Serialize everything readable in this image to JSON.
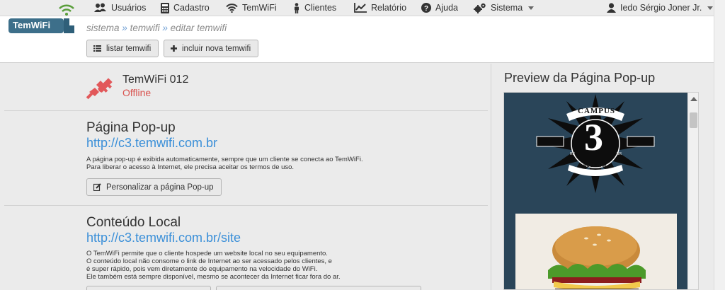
{
  "nav": {
    "items": [
      {
        "label": "Usuários",
        "icon": "users-icon"
      },
      {
        "label": "Cadastro",
        "icon": "calculator-icon"
      },
      {
        "label": "TemWiFi",
        "icon": "wifi-icon"
      },
      {
        "label": "Clientes",
        "icon": "person-icon"
      },
      {
        "label": "Relatório",
        "icon": "chart-icon"
      },
      {
        "label": "Ajuda",
        "icon": "help-icon"
      },
      {
        "label": "Sistema",
        "icon": "gears-icon"
      }
    ],
    "user": "Iedo Sérgio Joner Jr."
  },
  "logo": {
    "text": "TemWiFi"
  },
  "breadcrumb": {
    "part1": "sistema",
    "sep": "»",
    "part2": "temwifi",
    "part3": "editar temwifi"
  },
  "toolbar": {
    "list_label": "listar temwifi",
    "add_label": "incluir nova temwifi"
  },
  "device": {
    "name": "TemWiFi 012",
    "status": "Offline"
  },
  "popup": {
    "title": "Página Pop-up",
    "url": "http://c3.temwifi.com.br",
    "desc1": "A página pop-up é exibida automaticamente, sempre que um cliente se conecta ao TemWiFi.",
    "desc2": "Para liberar o acesso à Internet, ele precisa aceitar os termos de uso.",
    "button": "Personalizar a página Pop-up"
  },
  "local": {
    "title": "Conteúdo Local",
    "url": "http://c3.temwifi.com.br/site",
    "desc1": "O TemWiFi permite que o cliente hospede um website local no seu equipamento.",
    "desc2": "O conteúdo local não consome o link de Internet ao ser acessado pelos clientes, e",
    "desc3": "é super rápido, pois vem diretamente do equipamento na velocidade do WiFi.",
    "desc4": "Ele também está sempre disponível, mesmo se acontecer da Internet ficar fora do ar."
  },
  "preview": {
    "title": "Preview da Página Pop-up",
    "logo_top": "CAMPUS",
    "logo_number": "3",
    "logo_sub": "ROCK BAR",
    "logo_since": "SINCE 2009",
    "logo_left": "RS",
    "logo_right": "BR"
  },
  "colors": {
    "accent": "#3a8fd8",
    "offline": "#d9534f",
    "preview_bg": "#2a4559",
    "wifi_green": "#5a9e3b"
  }
}
